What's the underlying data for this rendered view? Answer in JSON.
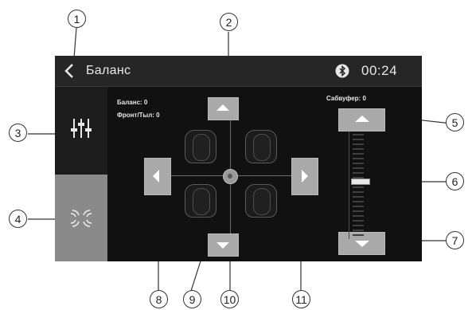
{
  "header": {
    "title": "Баланс",
    "time": "00:24"
  },
  "info": {
    "balance": "Баланс: 0",
    "front_rear": "Фронт/Тыл: 0",
    "subwoofer": "Сабвуфер: 0"
  },
  "icons": {
    "back": "chevron-left-icon",
    "bluetooth": "bluetooth-icon",
    "equalizer": "equalizer-icon",
    "balance": "balance-icon"
  },
  "subwoofer": {
    "level": 0
  },
  "callouts": [
    "1",
    "2",
    "3",
    "4",
    "5",
    "6",
    "7",
    "8",
    "9",
    "10",
    "11"
  ],
  "colors": {
    "screen_bg": "#111111",
    "topbar_bg": "#262626",
    "sidebar_active": "#8a8a8a",
    "button_gray": "#a9a9a9"
  }
}
